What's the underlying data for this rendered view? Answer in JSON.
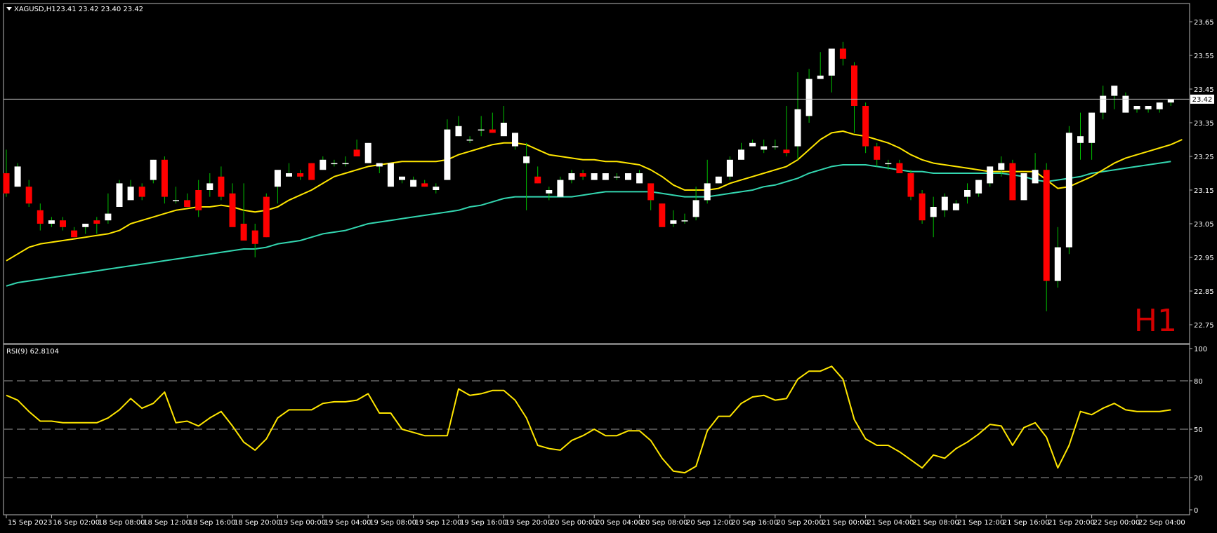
{
  "header": {
    "symbol_label": "XAGUSD,H1",
    "ohlc_text": "23.41 23.42 23.40 23.42",
    "menu_icon": "triangle-down-icon"
  },
  "watermark": "H1",
  "colors": {
    "background": "#000000",
    "frame": "#b8b8b8",
    "bull_candle": "#ffffff",
    "bear_candle": "#ff0000",
    "wick": "#00c000",
    "ma_fast": "#ffe600",
    "ma_slow": "#33d6b0",
    "rsi_line": "#ffe600",
    "watermark": "#d40000"
  },
  "price_axis": {
    "labels": [
      "23.65",
      "23.55",
      "23.45",
      "23.35",
      "23.25",
      "23.15",
      "23.05",
      "22.95",
      "22.85",
      "22.75"
    ],
    "current_price": "23.42"
  },
  "rsi": {
    "label": "RSI(9) 62.8104",
    "levels": [
      "100",
      "80",
      "50",
      "20",
      "0"
    ]
  },
  "time_axis": {
    "labels": [
      "15 Sep 2023",
      "16 Sep 02:00",
      "18 Sep 08:00",
      "18 Sep 12:00",
      "18 Sep 16:00",
      "18 Sep 20:00",
      "19 Sep 00:00",
      "19 Sep 04:00",
      "19 Sep 08:00",
      "19 Sep 12:00",
      "19 Sep 16:00",
      "19 Sep 20:00",
      "20 Sep 00:00",
      "20 Sep 04:00",
      "20 Sep 08:00",
      "20 Sep 12:00",
      "20 Sep 16:00",
      "20 Sep 20:00",
      "21 Sep 00:00",
      "21 Sep 04:00",
      "21 Sep 08:00",
      "21 Sep 12:00",
      "21 Sep 16:00",
      "21 Sep 20:00",
      "22 Sep 00:00",
      "22 Sep 04:00"
    ]
  },
  "chart_data": {
    "type": "candlestick",
    "symbol": "XAGUSD",
    "timeframe": "H1",
    "ylim": [
      22.7,
      23.68
    ],
    "rsi_ylim": [
      0,
      100
    ],
    "candles": [
      [
        23.2,
        23.27,
        23.13,
        23.14
      ],
      [
        23.16,
        23.23,
        23.16,
        23.22
      ],
      [
        23.16,
        23.18,
        23.1,
        23.11
      ],
      [
        23.09,
        23.11,
        23.03,
        23.05
      ],
      [
        23.05,
        23.07,
        23.04,
        23.06
      ],
      [
        23.06,
        23.07,
        23.03,
        23.04
      ],
      [
        23.03,
        23.04,
        23.01,
        23.01
      ],
      [
        23.04,
        23.05,
        23.02,
        23.05
      ],
      [
        23.06,
        23.07,
        23.02,
        23.05
      ],
      [
        23.06,
        23.14,
        23.05,
        23.08
      ],
      [
        23.1,
        23.18,
        23.1,
        23.17
      ],
      [
        23.12,
        23.18,
        23.12,
        23.16
      ],
      [
        23.16,
        23.17,
        23.12,
        23.13
      ],
      [
        23.18,
        23.24,
        23.17,
        23.24
      ],
      [
        23.24,
        23.25,
        23.11,
        23.13
      ],
      [
        23.12,
        23.16,
        23.11,
        23.12
      ],
      [
        23.12,
        23.14,
        23.1,
        23.1
      ],
      [
        23.15,
        23.18,
        23.07,
        23.09
      ],
      [
        23.15,
        23.2,
        23.13,
        23.17
      ],
      [
        23.19,
        23.22,
        23.12,
        23.13
      ],
      [
        23.14,
        23.17,
        23.08,
        23.04
      ],
      [
        23.05,
        23.17,
        23.0,
        23.0
      ],
      [
        23.03,
        23.05,
        22.95,
        22.99
      ],
      [
        23.13,
        23.14,
        23.01,
        23.01
      ],
      [
        23.16,
        23.19,
        23.11,
        23.21
      ],
      [
        23.19,
        23.23,
        23.19,
        23.2
      ],
      [
        23.2,
        23.21,
        23.18,
        23.19
      ],
      [
        23.23,
        23.23,
        23.18,
        23.18
      ],
      [
        23.21,
        23.25,
        23.21,
        23.24
      ],
      [
        23.23,
        23.24,
        23.22,
        23.23
      ],
      [
        23.23,
        23.25,
        23.22,
        23.23
      ],
      [
        23.27,
        23.3,
        23.25,
        23.25
      ],
      [
        23.23,
        23.29,
        23.23,
        23.29
      ],
      [
        23.22,
        23.23,
        23.2,
        23.23
      ],
      [
        23.16,
        23.23,
        23.16,
        23.23
      ],
      [
        23.18,
        23.19,
        23.17,
        23.19
      ],
      [
        23.16,
        23.19,
        23.16,
        23.18
      ],
      [
        23.17,
        23.18,
        23.16,
        23.16
      ],
      [
        23.15,
        23.17,
        23.14,
        23.16
      ],
      [
        23.18,
        23.36,
        23.18,
        23.33
      ],
      [
        23.31,
        23.37,
        23.31,
        23.34
      ],
      [
        23.3,
        23.31,
        23.29,
        23.3
      ],
      [
        23.33,
        23.37,
        23.31,
        23.33
      ],
      [
        23.33,
        23.38,
        23.32,
        23.32
      ],
      [
        23.31,
        23.4,
        23.31,
        23.35
      ],
      [
        23.28,
        23.32,
        23.27,
        23.32
      ],
      [
        23.23,
        23.29,
        23.09,
        23.25
      ],
      [
        23.19,
        23.22,
        23.17,
        23.17
      ],
      [
        23.14,
        23.16,
        23.12,
        23.15
      ],
      [
        23.13,
        23.19,
        23.13,
        23.18
      ],
      [
        23.18,
        23.21,
        23.17,
        23.2
      ],
      [
        23.2,
        23.21,
        23.18,
        23.19
      ],
      [
        23.18,
        23.2,
        23.18,
        23.2
      ],
      [
        23.18,
        23.2,
        23.18,
        23.2
      ],
      [
        23.19,
        23.2,
        23.18,
        23.19
      ],
      [
        23.18,
        23.2,
        23.18,
        23.2
      ],
      [
        23.17,
        23.21,
        23.17,
        23.2
      ],
      [
        23.17,
        23.17,
        23.09,
        23.12
      ],
      [
        23.11,
        23.11,
        23.04,
        23.04
      ],
      [
        23.05,
        23.09,
        23.04,
        23.06
      ],
      [
        23.06,
        23.08,
        23.05,
        23.06
      ],
      [
        23.07,
        23.16,
        23.06,
        23.12
      ],
      [
        23.12,
        23.24,
        23.11,
        23.17
      ],
      [
        23.17,
        23.19,
        23.17,
        23.19
      ],
      [
        23.19,
        23.25,
        23.18,
        23.24
      ],
      [
        23.24,
        23.29,
        23.24,
        23.27
      ],
      [
        23.28,
        23.3,
        23.28,
        23.29
      ],
      [
        23.27,
        23.3,
        23.26,
        23.28
      ],
      [
        23.28,
        23.3,
        23.27,
        23.28
      ],
      [
        23.27,
        23.4,
        23.25,
        23.26
      ],
      [
        23.28,
        23.5,
        23.24,
        23.39
      ],
      [
        23.37,
        23.51,
        23.35,
        23.48
      ],
      [
        23.48,
        23.56,
        23.48,
        23.49
      ],
      [
        23.49,
        23.56,
        23.44,
        23.57
      ],
      [
        23.57,
        23.59,
        23.52,
        23.54
      ],
      [
        23.52,
        23.53,
        23.32,
        23.4
      ],
      [
        23.4,
        23.41,
        23.26,
        23.28
      ],
      [
        23.28,
        23.29,
        23.22,
        23.24
      ],
      [
        23.23,
        23.24,
        23.21,
        23.23
      ],
      [
        23.23,
        23.24,
        23.2,
        23.2
      ],
      [
        23.2,
        23.21,
        23.12,
        23.13
      ],
      [
        23.14,
        23.15,
        23.05,
        23.06
      ],
      [
        23.07,
        23.13,
        23.01,
        23.1
      ],
      [
        23.09,
        23.14,
        23.07,
        23.13
      ],
      [
        23.09,
        23.12,
        23.09,
        23.11
      ],
      [
        23.13,
        23.17,
        23.11,
        23.15
      ],
      [
        23.14,
        23.18,
        23.13,
        23.18
      ],
      [
        23.17,
        23.22,
        23.16,
        23.22
      ],
      [
        23.21,
        23.25,
        23.19,
        23.23
      ],
      [
        23.23,
        23.24,
        23.12,
        23.12
      ],
      [
        23.12,
        23.2,
        23.12,
        23.2
      ],
      [
        23.17,
        23.26,
        23.17,
        23.21
      ],
      [
        23.21,
        23.23,
        22.79,
        22.88
      ],
      [
        22.88,
        23.04,
        22.86,
        22.98
      ],
      [
        22.98,
        23.34,
        22.96,
        23.32
      ],
      [
        23.29,
        23.38,
        23.24,
        23.31
      ],
      [
        23.29,
        23.38,
        23.24,
        23.38
      ],
      [
        23.38,
        23.46,
        23.36,
        23.43
      ],
      [
        23.43,
        23.46,
        23.39,
        23.46
      ],
      [
        23.38,
        23.44,
        23.38,
        23.43
      ],
      [
        23.39,
        23.4,
        23.38,
        23.4
      ],
      [
        23.39,
        23.4,
        23.38,
        23.4
      ],
      [
        23.39,
        23.41,
        23.38,
        23.41
      ],
      [
        23.41,
        23.42,
        23.4,
        23.42
      ]
    ],
    "ma_fast": [
      22.94,
      22.96,
      22.98,
      22.99,
      22.995,
      23.0,
      23.005,
      23.01,
      23.015,
      23.02,
      23.03,
      23.05,
      23.06,
      23.07,
      23.08,
      23.09,
      23.095,
      23.1,
      23.1,
      23.105,
      23.1,
      23.09,
      23.085,
      23.09,
      23.1,
      23.12,
      23.135,
      23.15,
      23.17,
      23.19,
      23.2,
      23.21,
      23.22,
      23.225,
      23.23,
      23.235,
      23.235,
      23.235,
      23.235,
      23.24,
      23.255,
      23.265,
      23.275,
      23.285,
      23.29,
      23.29,
      23.285,
      23.27,
      23.255,
      23.25,
      23.245,
      23.24,
      23.24,
      23.235,
      23.235,
      23.23,
      23.225,
      23.21,
      23.19,
      23.165,
      23.15,
      23.15,
      23.15,
      23.155,
      23.17,
      23.18,
      23.19,
      23.2,
      23.21,
      23.22,
      23.24,
      23.27,
      23.3,
      23.32,
      23.325,
      23.315,
      23.31,
      23.3,
      23.29,
      23.275,
      23.255,
      23.24,
      23.23,
      23.225,
      23.22,
      23.215,
      23.21,
      23.205,
      23.205,
      23.205,
      23.205,
      23.205,
      23.18,
      23.155,
      23.16,
      23.175,
      23.19,
      23.21,
      23.23,
      23.245,
      23.255,
      23.265,
      23.275,
      23.285,
      23.3
    ],
    "ma_slow": [
      22.865,
      22.875,
      22.88,
      22.885,
      22.89,
      22.895,
      22.9,
      22.905,
      22.91,
      22.915,
      22.92,
      22.925,
      22.93,
      22.935,
      22.94,
      22.945,
      22.95,
      22.955,
      22.96,
      22.965,
      22.97,
      22.975,
      22.975,
      22.98,
      22.99,
      22.995,
      23.0,
      23.01,
      23.02,
      23.025,
      23.03,
      23.04,
      23.05,
      23.055,
      23.06,
      23.065,
      23.07,
      23.075,
      23.08,
      23.085,
      23.09,
      23.1,
      23.105,
      23.115,
      23.125,
      23.13,
      23.13,
      23.13,
      23.13,
      23.13,
      23.13,
      23.135,
      23.14,
      23.145,
      23.145,
      23.145,
      23.145,
      23.145,
      23.14,
      23.135,
      23.13,
      23.13,
      23.13,
      23.135,
      23.14,
      23.145,
      23.15,
      23.16,
      23.165,
      23.175,
      23.185,
      23.2,
      23.21,
      23.22,
      23.225,
      23.225,
      23.225,
      23.22,
      23.215,
      23.21,
      23.205,
      23.205,
      23.2,
      23.2,
      23.2,
      23.2,
      23.2,
      23.2,
      23.2,
      23.195,
      23.19,
      23.18,
      23.175,
      23.18,
      23.185,
      23.19,
      23.2,
      23.205,
      23.21,
      23.215,
      23.22,
      23.225,
      23.23,
      23.235
    ],
    "rsi": [
      71,
      68,
      61,
      55,
      55,
      54,
      54,
      54,
      54,
      57,
      62,
      69,
      63,
      66,
      73,
      54,
      55,
      52,
      57,
      61,
      52,
      42,
      37,
      44,
      57,
      62,
      62,
      62,
      66,
      67,
      67,
      68,
      72,
      60,
      60,
      50,
      48,
      46,
      46,
      46,
      75,
      71,
      72,
      74,
      74,
      68,
      57,
      40,
      38,
      37,
      43,
      46,
      50,
      46,
      46,
      49,
      49,
      43,
      32,
      24,
      23,
      27,
      49,
      58,
      58,
      66,
      70,
      71,
      68,
      69,
      81,
      86,
      86,
      89,
      81,
      56,
      44,
      40,
      40,
      36,
      31,
      26,
      34,
      32,
      38,
      42,
      47,
      53,
      52,
      40,
      51,
      54,
      45,
      26,
      40,
      61,
      59,
      63,
      66,
      62,
      61,
      61,
      61,
      62
    ]
  }
}
